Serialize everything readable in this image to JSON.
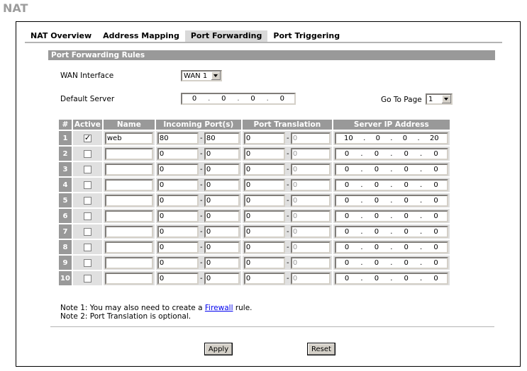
{
  "page": {
    "title": "NAT"
  },
  "tabs": [
    {
      "label": "NAT Overview",
      "active": false
    },
    {
      "label": "Address Mapping",
      "active": false
    },
    {
      "label": "Port Forwarding",
      "active": true
    },
    {
      "label": "Port Triggering",
      "active": false
    }
  ],
  "section": {
    "title": "Port Forwarding Rules"
  },
  "wan_interface": {
    "label": "WAN Interface",
    "value": "WAN 1"
  },
  "default_server": {
    "label": "Default Server",
    "ip": [
      "0",
      "0",
      "0",
      "0"
    ]
  },
  "goto_page": {
    "label": "Go To Page",
    "value": "1"
  },
  "table": {
    "headers": [
      "#",
      "Active",
      "Name",
      "Incoming Port(s)",
      "Port Translation",
      "Server IP Address"
    ],
    "rows": [
      {
        "num": "1",
        "active": true,
        "name": "web",
        "in_start": "80",
        "in_end": "80",
        "tr_start": "0",
        "tr_end": "0",
        "ip": [
          "10",
          "0",
          "0",
          "20"
        ]
      },
      {
        "num": "2",
        "active": false,
        "name": "",
        "in_start": "0",
        "in_end": "0",
        "tr_start": "0",
        "tr_end": "0",
        "ip": [
          "0",
          "0",
          "0",
          "0"
        ]
      },
      {
        "num": "3",
        "active": false,
        "name": "",
        "in_start": "0",
        "in_end": "0",
        "tr_start": "0",
        "tr_end": "0",
        "ip": [
          "0",
          "0",
          "0",
          "0"
        ]
      },
      {
        "num": "4",
        "active": false,
        "name": "",
        "in_start": "0",
        "in_end": "0",
        "tr_start": "0",
        "tr_end": "0",
        "ip": [
          "0",
          "0",
          "0",
          "0"
        ]
      },
      {
        "num": "5",
        "active": false,
        "name": "",
        "in_start": "0",
        "in_end": "0",
        "tr_start": "0",
        "tr_end": "0",
        "ip": [
          "0",
          "0",
          "0",
          "0"
        ]
      },
      {
        "num": "6",
        "active": false,
        "name": "",
        "in_start": "0",
        "in_end": "0",
        "tr_start": "0",
        "tr_end": "0",
        "ip": [
          "0",
          "0",
          "0",
          "0"
        ]
      },
      {
        "num": "7",
        "active": false,
        "name": "",
        "in_start": "0",
        "in_end": "0",
        "tr_start": "0",
        "tr_end": "0",
        "ip": [
          "0",
          "0",
          "0",
          "0"
        ]
      },
      {
        "num": "8",
        "active": false,
        "name": "",
        "in_start": "0",
        "in_end": "0",
        "tr_start": "0",
        "tr_end": "0",
        "ip": [
          "0",
          "0",
          "0",
          "0"
        ]
      },
      {
        "num": "9",
        "active": false,
        "name": "",
        "in_start": "0",
        "in_end": "0",
        "tr_start": "0",
        "tr_end": "0",
        "ip": [
          "0",
          "0",
          "0",
          "0"
        ]
      },
      {
        "num": "10",
        "active": false,
        "name": "",
        "in_start": "0",
        "in_end": "0",
        "tr_start": "0",
        "tr_end": "0",
        "ip": [
          "0",
          "0",
          "0",
          "0"
        ]
      }
    ]
  },
  "notes": {
    "note1_prefix": "Note 1: You may also need to create a ",
    "note1_link": "Firewall",
    "note1_suffix": " rule.",
    "note2": "Note 2: Port Translation is optional."
  },
  "buttons": {
    "apply": "Apply",
    "reset": "Reset"
  },
  "colors": {
    "header_bg": "#999999",
    "tab_active_bg": "#d9d9d9",
    "cell_bg": "#e0e0e0",
    "title_color": "#9c9c9c",
    "link": "#0000ee"
  }
}
